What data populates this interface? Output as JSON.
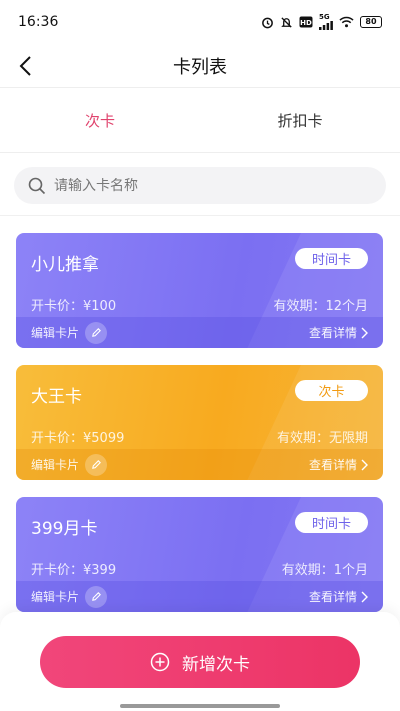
{
  "status_bar": {
    "time": "16:36",
    "network": "5G",
    "battery": "80",
    "icons": [
      "alarm-icon",
      "mute-icon",
      "hd-icon",
      "signal-icon",
      "wifi-icon",
      "battery-icon"
    ]
  },
  "header": {
    "title": "卡列表",
    "back_icon": "chevron-left-icon"
  },
  "tabs": [
    {
      "label": "次卡",
      "active": true
    },
    {
      "label": "折扣卡",
      "active": false
    }
  ],
  "search": {
    "placeholder": "请输入卡名称",
    "value": ""
  },
  "cards": [
    {
      "name": "小儿推拿",
      "badge": "时间卡",
      "price": "开卡价：¥100",
      "validity": "有效期：12个月",
      "edit_label": "编辑卡片",
      "detail_label": "查看详情",
      "theme": "purple"
    },
    {
      "name": "大王卡",
      "badge": "次卡",
      "price": "开卡价：¥5099",
      "validity": "有效期：无限期",
      "edit_label": "编辑卡片",
      "detail_label": "查看详情",
      "theme": "orange"
    },
    {
      "name": "399月卡",
      "badge": "时间卡",
      "price": "开卡价：¥399",
      "validity": "有效期：1个月",
      "edit_label": "编辑卡片",
      "detail_label": "查看详情",
      "theme": "purple"
    }
  ],
  "footer": {
    "add_button_label": "新增次卡"
  },
  "colors": {
    "accent": "#e0436d",
    "purple_card": "#7b6ff2",
    "orange_card": "#f8aa1f",
    "button": "#ec3466"
  }
}
